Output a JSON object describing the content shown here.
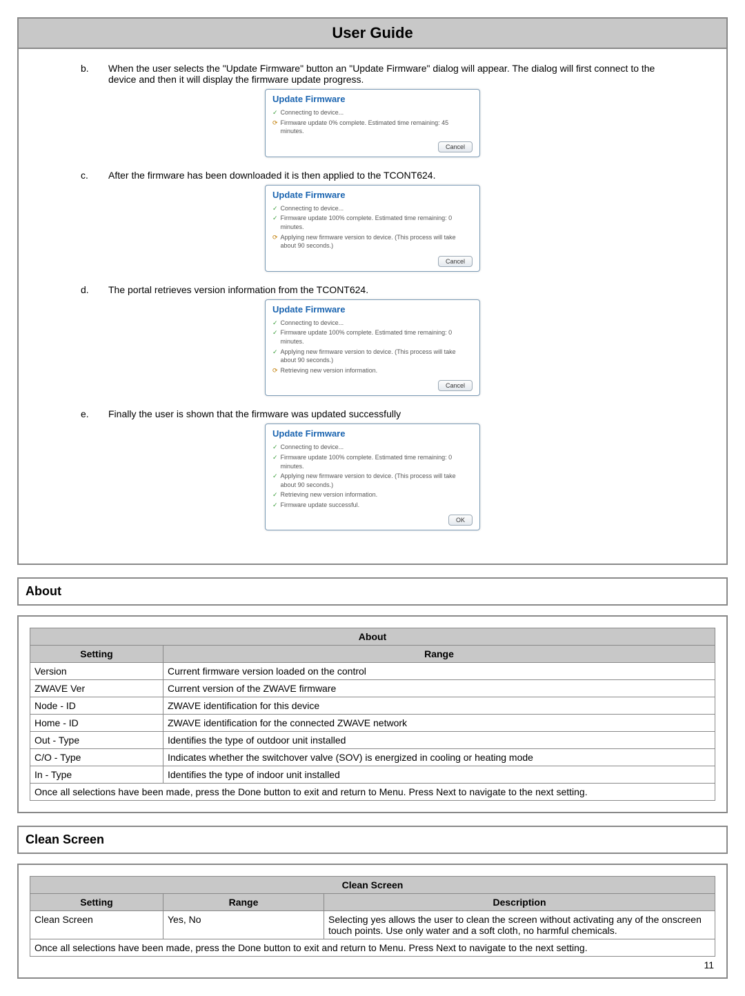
{
  "header": {
    "title": "User Guide"
  },
  "body": {
    "items": [
      {
        "letter": "b.",
        "text": "When the user selects the \"Update Firmware\" button an \"Update Firmware\" dialog will appear.  The dialog will first connect to the device and then it will display the firmware update progress.",
        "dialog": {
          "title": "Update Firmware",
          "lines": [
            {
              "icon": "check",
              "text": "Connecting to device..."
            },
            {
              "icon": "spin",
              "text": "Firmware update 0% complete. Estimated time remaining: 45 minutes."
            }
          ],
          "button": "Cancel"
        }
      },
      {
        "letter": "c.",
        "text": "After the firmware has been downloaded it is then applied to the TCONT624.",
        "dialog": {
          "title": "Update Firmware",
          "lines": [
            {
              "icon": "check",
              "text": "Connecting to device..."
            },
            {
              "icon": "check",
              "text": "Firmware update 100% complete. Estimated time remaining: 0 minutes."
            },
            {
              "icon": "spin",
              "text": "Applying new firmware version to device. (This process will take about 90 seconds.)"
            }
          ],
          "button": "Cancel"
        }
      },
      {
        "letter": "d.",
        "text": "The portal retrieves version information from the TCONT624.",
        "dialog": {
          "title": "Update Firmware",
          "lines": [
            {
              "icon": "check",
              "text": "Connecting to device..."
            },
            {
              "icon": "check",
              "text": "Firmware update 100% complete. Estimated time remaining: 0 minutes."
            },
            {
              "icon": "check",
              "text": "Applying new firmware version to device. (This process will take about 90 seconds.)"
            },
            {
              "icon": "spin",
              "text": "Retrieving new version information."
            }
          ],
          "button": "Cancel"
        }
      },
      {
        "letter": "e.",
        "text": "Finally the user is shown that the firmware was updated successfully",
        "dialog": {
          "title": "Update Firmware",
          "lines": [
            {
              "icon": "check",
              "text": "Connecting to device..."
            },
            {
              "icon": "check",
              "text": "Firmware update 100% complete. Estimated time remaining: 0 minutes."
            },
            {
              "icon": "check",
              "text": "Applying new firmware version to device. (This process will take about 90 seconds.)"
            },
            {
              "icon": "check",
              "text": "Retrieving new version information."
            },
            {
              "icon": "check",
              "text": "Firmware update successful."
            }
          ],
          "button": "OK"
        }
      }
    ]
  },
  "sections": {
    "about": {
      "heading": "About",
      "table": {
        "title": "About",
        "cols": [
          "Setting",
          "Range"
        ],
        "rows": [
          [
            "Version",
            "Current firmware version loaded on the control"
          ],
          [
            "ZWAVE Ver",
            "Current version of the ZWAVE firmware"
          ],
          [
            "Node - ID",
            "ZWAVE identification for this device"
          ],
          [
            "Home - ID",
            "ZWAVE identification for the connected ZWAVE network"
          ],
          [
            "Out - Type",
            "Identifies the type of outdoor unit installed"
          ],
          [
            "C/O - Type",
            "Indicates whether the switchover valve (SOV) is energized in cooling or heating mode"
          ],
          [
            "In - Type",
            "Identifies the type of indoor unit installed"
          ]
        ],
        "footer": "Once all selections have been made, press the Done button to exit and return to Menu. Press Next to navigate to the next setting."
      }
    },
    "clean": {
      "heading": "Clean Screen",
      "table": {
        "title": "Clean Screen",
        "cols": [
          "Setting",
          "Range",
          "Description"
        ],
        "rows": [
          [
            "Clean Screen",
            "Yes, No",
            "Selecting yes allows the user to clean the screen without activating any of the onscreen touch points. Use only water and a soft cloth, no harmful chemicals."
          ]
        ],
        "footer": "Once all selections have been made, press the Done button to exit and return to Menu. Press Next to navigate to the next setting."
      }
    }
  },
  "page_number": "11"
}
